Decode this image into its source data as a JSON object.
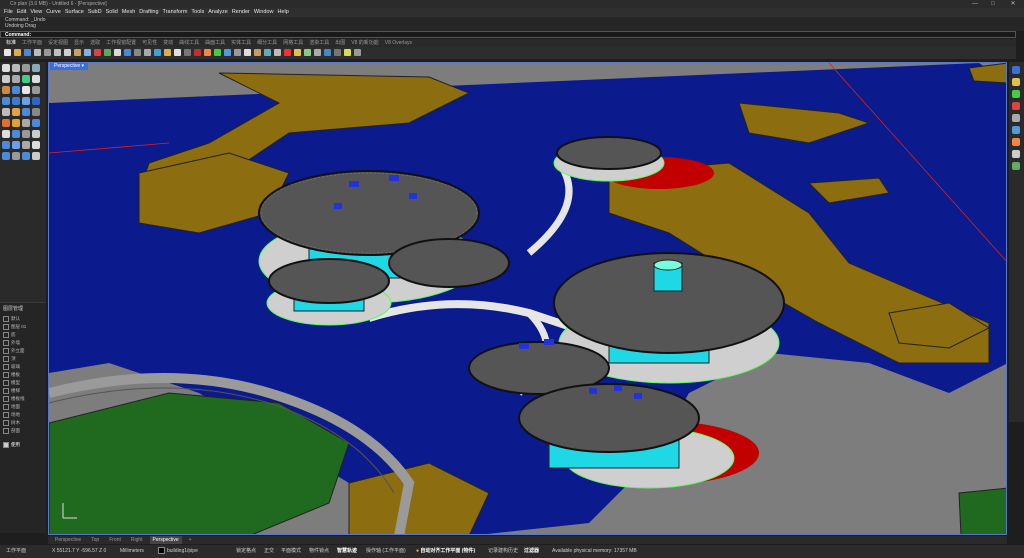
{
  "titlebar": {
    "title": "Cir plan (3.0 MB) - Untitled 6 - [Perspective]",
    "minimize": "—",
    "maximize": "□",
    "close": "✕"
  },
  "menu": [
    "File",
    "Edit",
    "View",
    "Curve",
    "Surface",
    "SubD",
    "Solid",
    "Mesh",
    "Drafting",
    "Transform",
    "Tools",
    "Analyze",
    "Render",
    "Window",
    "Help"
  ],
  "command": {
    "history": [
      "Command: _Undo",
      "Undoing Drag"
    ],
    "prompt": "Command:"
  },
  "toolbar_tabs": [
    "标准",
    "工作平面",
    "设定视图",
    "显示",
    "选取",
    "工作视窗配置",
    "可见性",
    "变动",
    "曲线工具",
    "曲面工具",
    "实体工具",
    "细分工具",
    "网格工具",
    "渲染工具",
    "出图",
    "V8 的新功能",
    "V8 Overlays"
  ],
  "viewport": {
    "label": "Perspective",
    "menu_arrow": "▾"
  },
  "layers": {
    "header": "图层管理",
    "rows": [
      "默认",
      "图层 01",
      "底",
      "外墙",
      "外立面",
      "顶",
      "玻璃",
      "楼板",
      "模型",
      "楼梯",
      "楼板线",
      "地面",
      "场地",
      "树木",
      "剖面"
    ],
    "footer": "使用"
  },
  "view_tabs": [
    "Perspective",
    "Top",
    "Front",
    "Right",
    "Perspective"
  ],
  "view_tab_add": "+",
  "status": {
    "cplane": "工作平面",
    "coords": "X 55121.7 Y -596.57 Z 0",
    "units": "Millimeters",
    "layer": "building1/pipe",
    "snaps": [
      "锁定格点",
      "正交",
      "平面模式",
      "物件锁点",
      "智慧轨迹",
      "操作轴 (工作平面)"
    ],
    "autoalign": "自动对齐工作平面 (物件)",
    "record": "记录建构历史",
    "filter": "过滤器",
    "memory": "Available physical memory: 17357 MB"
  },
  "colors": {
    "ocean": "#0b1a8c",
    "land": "#8c6d10",
    "grass": "#1f6a1e",
    "glass": "#1ed8e6",
    "accent": "#3a6fd8"
  }
}
